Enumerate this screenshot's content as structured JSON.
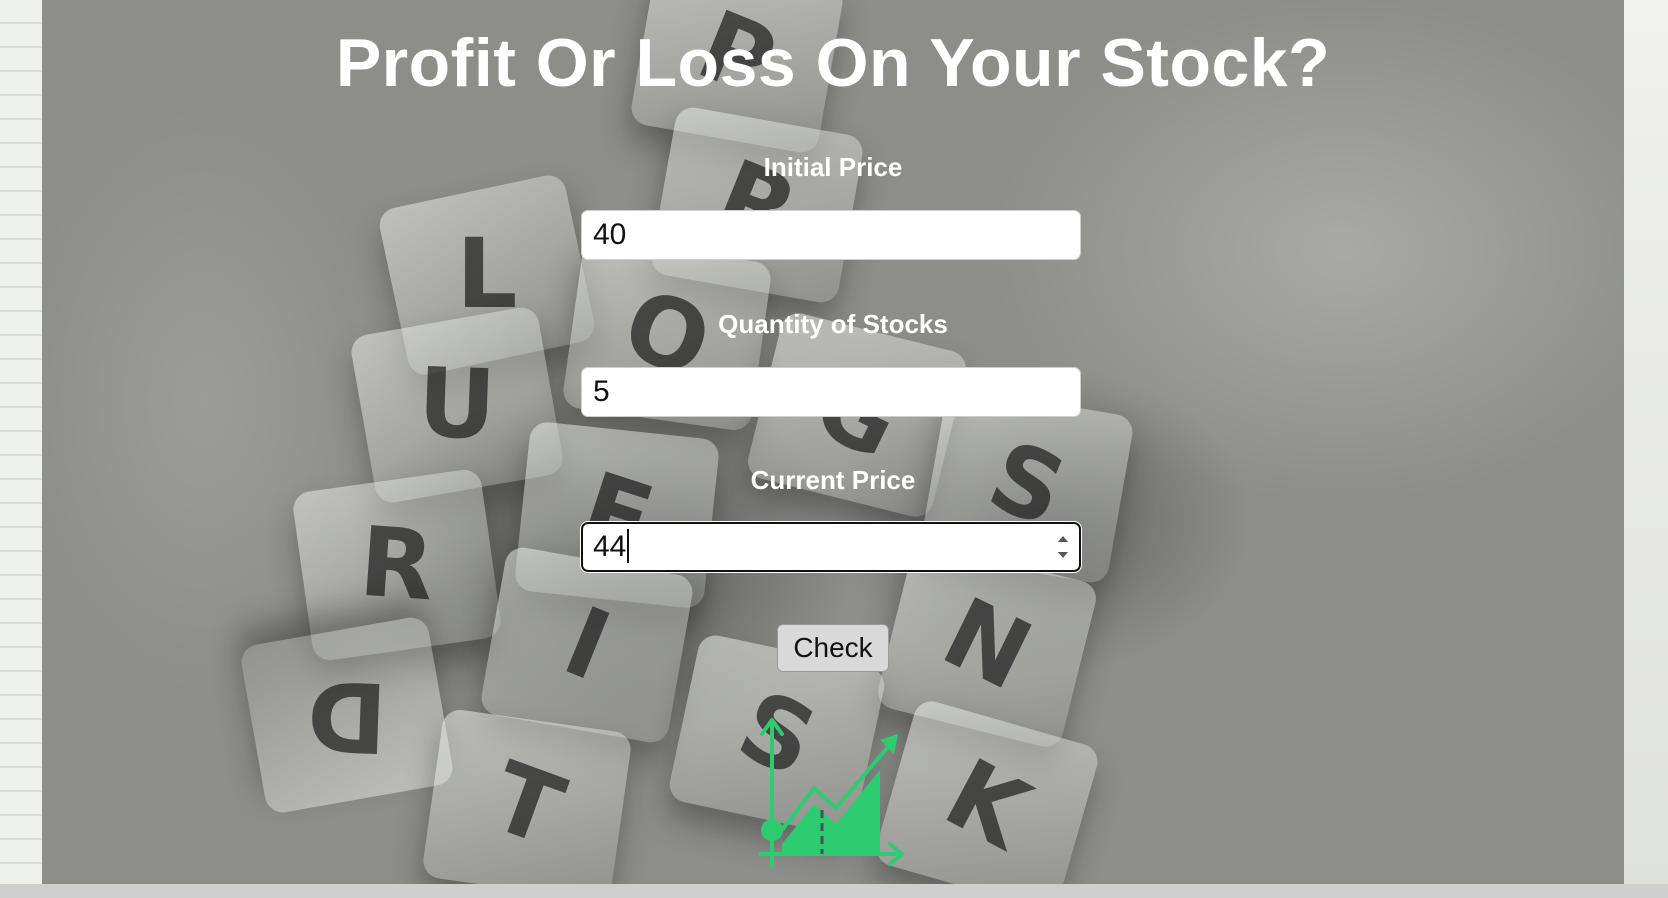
{
  "app": {
    "title": "Profit Or Loss On Your Stock?"
  },
  "form": {
    "initial_price": {
      "label": "Initial Price",
      "value": "40"
    },
    "quantity": {
      "label": "Quantity of Stocks",
      "value": "5"
    },
    "current_price": {
      "label": "Current Price",
      "value": "44"
    },
    "check_button_label": "Check"
  },
  "background": {
    "tile_letters": [
      "P",
      "R",
      "L",
      "O",
      "U",
      "G",
      "S",
      "F",
      "R",
      "I",
      "N",
      "D",
      "S",
      "T",
      "K"
    ]
  },
  "icons": {
    "chart": "growth-chart-icon"
  },
  "colors": {
    "title": "#ffffff",
    "accent_green": "#2ecc71",
    "field_bg": "#ffffff",
    "button_bg": "#d9d9d9"
  }
}
